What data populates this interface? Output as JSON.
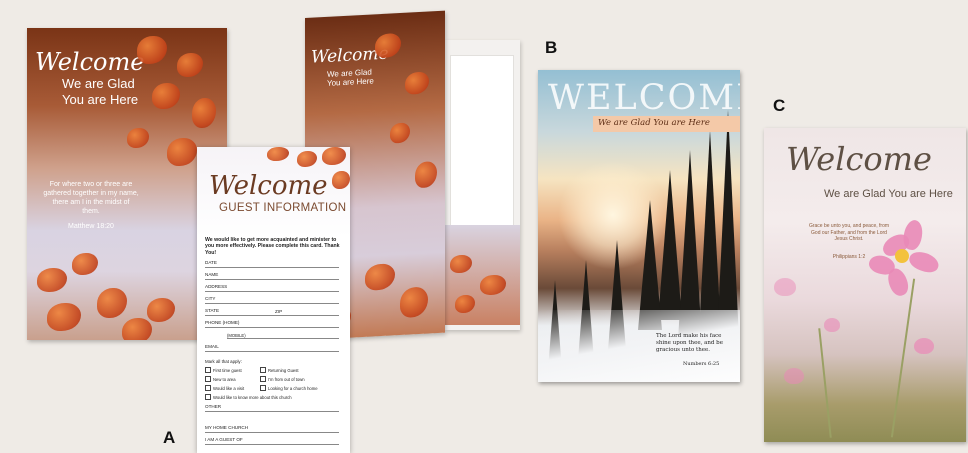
{
  "labels": {
    "a": "A",
    "b": "B",
    "c": "C"
  },
  "card_a": {
    "welcome": "Welcome",
    "line1": "We are Glad",
    "line2": "You are Here",
    "verse": "For where two or three are gathered together in my name, there am I in the midst of them.",
    "reference": "Matthew 18:20"
  },
  "folder": {
    "welcome": "Welcome",
    "line1": "We are Glad",
    "line2": "You are Here"
  },
  "guest_card": {
    "welcome": "Welcome",
    "title": "GUEST INFORMATION",
    "intro": "We would like to get more acquainted and minister to you more effectively. Please complete this card. Thank You!",
    "fields": [
      "DATE",
      "NAME",
      "ADDRESS",
      "CITY",
      "STATE",
      "PHONE (HOME)",
      "EMAIL"
    ],
    "zip": "ZIP",
    "mobile": "(MOBILE)",
    "mark_all": "Mark all that apply:",
    "checkboxes_left": [
      "First time guest",
      "New to area",
      "Would like a visit",
      "Would like to know more about this church"
    ],
    "checkboxes_right": [
      "Returning Guest",
      "I'm from out of town",
      "Looking for a church home"
    ],
    "other": "OTHER",
    "home_church": "MY HOME CHURCH",
    "guest_of": "I AM A GUEST OF"
  },
  "card_b": {
    "title": "WELCOME",
    "subtitle": "We are Glad You are Here",
    "verse": "The Lord make his face shine upon thee, and be gracious unto thee.",
    "reference": "Numbers 6:25"
  },
  "card_c": {
    "title": "Welcome",
    "subtitle": "We are Glad You are Here",
    "verse": "Grace be unto you, and peace, from God our Father, and from the Lord Jesus Christ.",
    "reference": "Philippians 1:2"
  }
}
